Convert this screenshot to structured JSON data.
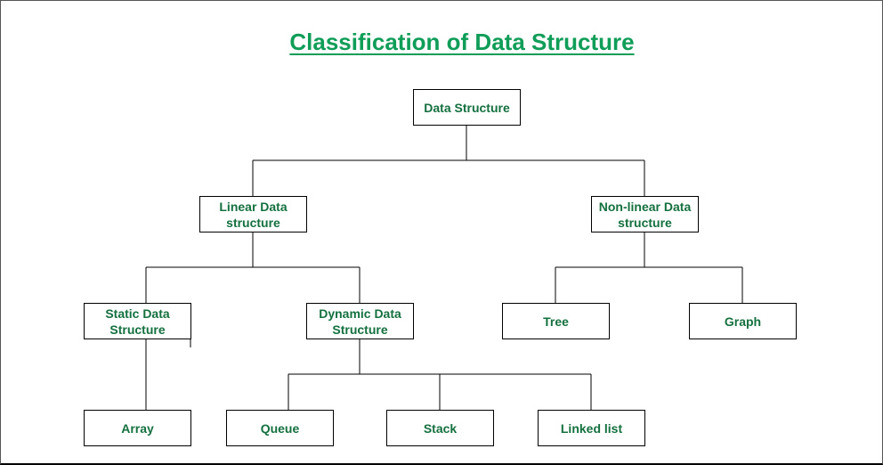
{
  "title": "Classification of Data Structure",
  "colors": {
    "title": "#0f9d58",
    "node_text": "#14703f",
    "line": "#000000"
  },
  "nodes": {
    "root": "Data Structure",
    "linear": "Linear Data structure",
    "nonlinear": "Non-linear Data structure",
    "static": "Static Data Structure",
    "dynamic": "Dynamic Data Structure",
    "tree": "Tree",
    "graph": "Graph",
    "array": "Array",
    "queue": "Queue",
    "stack": "Stack",
    "linkedlist": "Linked list"
  },
  "edges": [
    [
      "root",
      "linear"
    ],
    [
      "root",
      "nonlinear"
    ],
    [
      "linear",
      "static"
    ],
    [
      "linear",
      "dynamic"
    ],
    [
      "nonlinear",
      "tree"
    ],
    [
      "nonlinear",
      "graph"
    ],
    [
      "static",
      "array"
    ],
    [
      "dynamic",
      "queue"
    ],
    [
      "dynamic",
      "stack"
    ],
    [
      "dynamic",
      "linkedlist"
    ]
  ]
}
